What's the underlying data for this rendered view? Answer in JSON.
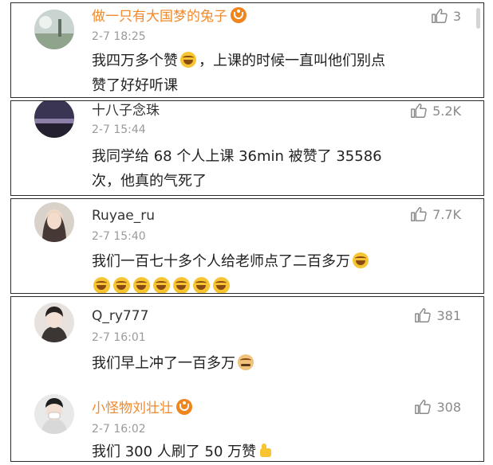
{
  "comments": [
    {
      "user": "做一只有大国梦的兔子",
      "vip": true,
      "time": "2-7 18:25",
      "likes": "3",
      "text_line1": "我四万多个赞",
      "text_line1b": "，上课的时候一直叫他们别点",
      "text_line2": "赞了好好听课"
    },
    {
      "user": "十八子念珠",
      "vip": false,
      "time": "2-7 15:44",
      "likes": "5.2K",
      "text_line1": "我同学给 68 个人上课 36min 被赞了 35586",
      "text_line2": "次，他真的气死了"
    },
    {
      "user": "Ruyae_ru",
      "vip": false,
      "time": "2-7 15:40",
      "likes": "7.7K",
      "text_line1": "我们一百七十多个人给老师点了二百多万"
    },
    {
      "user": "Q_ry777",
      "vip": false,
      "time": "2-7 16:01",
      "likes": "381",
      "text_line1": "我们早上冲了一百多万"
    },
    {
      "user": "小怪物刘壮壮",
      "vip": true,
      "time": "2-7 16:02",
      "likes": "308",
      "text_line1": "我们 300 人刷了 50 万赞"
    }
  ],
  "icons": {
    "like": "thumbs-up-icon",
    "laugh": "laughing-crying-emoji",
    "doge": "doge-emoji",
    "thumb": "thumbs-up-emoji",
    "vip": "vip-badge-icon"
  },
  "colors": {
    "vip_name": "#f08a2f",
    "time": "#9a9a9a",
    "text": "#222222",
    "border": "#2b2b2b"
  }
}
